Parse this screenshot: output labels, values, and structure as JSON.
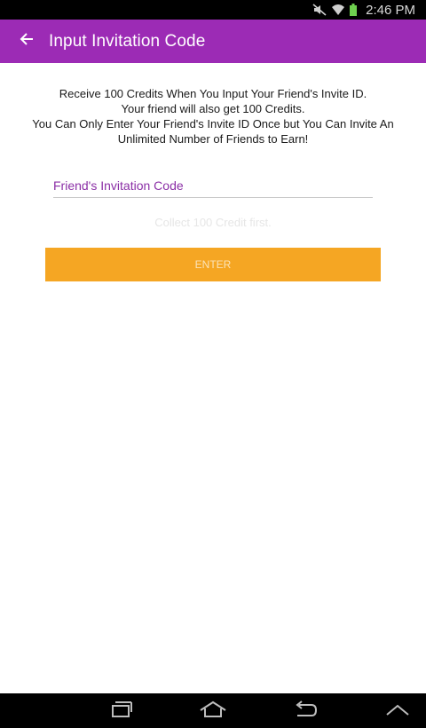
{
  "status_bar": {
    "time": "2:46 PM",
    "icons": [
      "mute-icon",
      "wifi-icon",
      "battery-icon"
    ]
  },
  "app_bar": {
    "title": "Input Invitation Code",
    "back_icon": "arrow-left-icon",
    "color": "#9c2bb5"
  },
  "message": {
    "lines": [
      "Receive 100 Credits When You Input Your Friend's Invite ID.",
      "Your friend will also get 100 Credits.",
      "You Can Only Enter Your Friend's Invite ID Once but You Can Invite An",
      "Unlimited Number of Friends to Earn!"
    ]
  },
  "code_input": {
    "placeholder": "Friend's Invitation Code",
    "value": ""
  },
  "hint": "Collect 100 Credit first.",
  "enter_button": {
    "label": "ENTER",
    "color": "#f5a623"
  },
  "nav_bar": {
    "icons": [
      "recent-apps-icon",
      "home-icon",
      "back-icon",
      "menu-up-icon"
    ]
  }
}
